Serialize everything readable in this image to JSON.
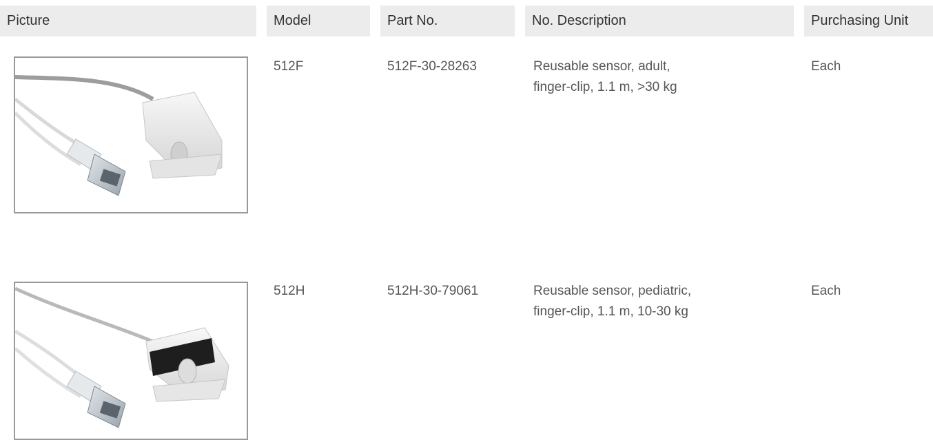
{
  "headers": {
    "picture": "Picture",
    "model": "Model",
    "part_no": "Part No.",
    "description": "No. Description",
    "unit": "Purchasing Unit"
  },
  "rows": [
    {
      "image_icon": "finger-clip-sensor-adult",
      "model": "512F",
      "part_no": "512F-30-28263",
      "description_line1": "Reusable sensor, adult,",
      "description_line2": "finger-clip, 1.1 m, >30 kg",
      "unit": "Each"
    },
    {
      "image_icon": "finger-clip-sensor-pediatric",
      "model": "512H",
      "part_no": "512H-30-79061",
      "description_line1": "Reusable sensor, pediatric,",
      "description_line2": "finger-clip, 1.1 m, 10-30 kg",
      "unit": "Each"
    }
  ]
}
